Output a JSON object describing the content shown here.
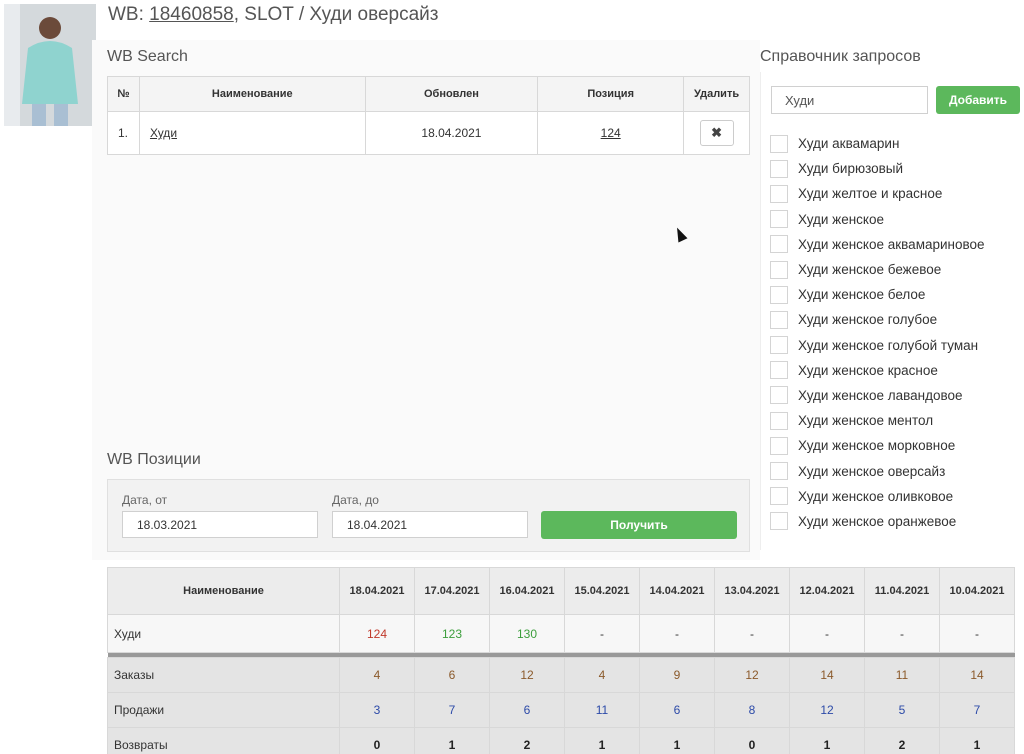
{
  "header": {
    "prefix": "WB: ",
    "article": "18460858",
    "suffix": ", SLOT / Худи оверсайз"
  },
  "wb_search": {
    "title": "WB Search",
    "columns": [
      "№",
      "Наименование",
      "Обновлен",
      "Позиция",
      "Удалить"
    ],
    "rows": [
      {
        "num": "1.",
        "name": "Худи",
        "updated": "18.04.2021",
        "position": "124",
        "delete_icon": "✖"
      }
    ]
  },
  "dictionary": {
    "title": "Справочник запросов",
    "input_value": "Худи",
    "add_label": "Добавить",
    "items": [
      "Худи аквамарин",
      "Худи бирюзовый",
      "Худи желтое и красное",
      "Худи женское",
      "Худи женское аквамариновое",
      "Худи женское бежевое",
      "Худи женское белое",
      "Худи женское голубое",
      "Худи женское голубой туман",
      "Худи женское красное",
      "Худи женское лавандовое",
      "Худи женское ментол",
      "Худи женское морковное",
      "Худи женское оверсайз",
      "Худи женское оливковое",
      "Худи женское оранжевое"
    ]
  },
  "wb_positions": {
    "title": "WB Позиции",
    "date_from_label": "Дата, от",
    "date_from_value": "18.03.2021",
    "date_to_label": "Дата, до",
    "date_to_value": "18.04.2021",
    "get_label": "Получить",
    "name_header": "Наименование",
    "dates": [
      "18.04.2021",
      "17.04.2021",
      "16.04.2021",
      "15.04.2021",
      "14.04.2021",
      "13.04.2021",
      "12.04.2021",
      "11.04.2021",
      "10.04.2021"
    ],
    "query_row": {
      "label": "Худи",
      "values": [
        "124",
        "123",
        "130",
        "-",
        "-",
        "-",
        "-",
        "-",
        "-"
      ]
    },
    "orders_row": {
      "label": "Заказы",
      "values": [
        "4",
        "6",
        "12",
        "4",
        "9",
        "12",
        "14",
        "11",
        "14"
      ]
    },
    "sales_row": {
      "label": "Продажи",
      "values": [
        "3",
        "7",
        "6",
        "11",
        "6",
        "8",
        "12",
        "5",
        "7"
      ]
    },
    "returns_row": {
      "label": "Возвраты",
      "values": [
        "0",
        "1",
        "2",
        "1",
        "1",
        "0",
        "1",
        "2",
        "1"
      ]
    }
  },
  "colors": {
    "accent_green": "#5cb85c",
    "position_down": "#c0392b",
    "position_up": "#3c9e3c",
    "orders": "#8b5a2b",
    "sales": "#2c4aa8"
  }
}
